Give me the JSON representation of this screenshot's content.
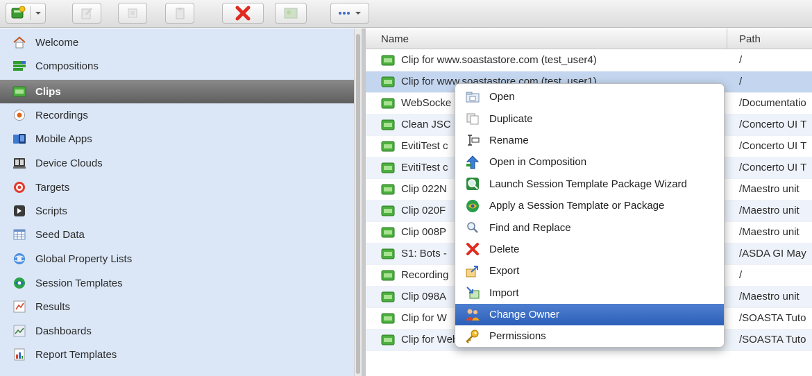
{
  "sidebar": {
    "items": [
      {
        "label": "Welcome",
        "icon": "home-icon"
      },
      {
        "label": "Compositions",
        "icon": "compositions-icon"
      },
      {
        "label": "Clips",
        "icon": "clip-icon",
        "selected": true
      },
      {
        "label": "Recordings",
        "icon": "recording-icon"
      },
      {
        "label": "Mobile Apps",
        "icon": "mobile-apps-icon"
      },
      {
        "label": "Device Clouds",
        "icon": "device-clouds-icon"
      },
      {
        "label": "Targets",
        "icon": "target-icon"
      },
      {
        "label": "Scripts",
        "icon": "scripts-icon"
      },
      {
        "label": "Seed Data",
        "icon": "seed-data-icon"
      },
      {
        "label": "Global Property Lists",
        "icon": "global-property-icon"
      },
      {
        "label": "Session Templates",
        "icon": "session-templates-icon"
      },
      {
        "label": "Results",
        "icon": "results-icon"
      },
      {
        "label": "Dashboards",
        "icon": "dashboards-icon"
      },
      {
        "label": "Report Templates",
        "icon": "report-templates-icon"
      }
    ]
  },
  "table": {
    "headers": {
      "name": "Name",
      "path": "Path"
    },
    "rows": [
      {
        "name": "Clip for www.soastastore.com (test_user4)",
        "path": "/"
      },
      {
        "name": "Clip for www.soastastore.com (test_user1)",
        "path": "/",
        "selected": true
      },
      {
        "name": "WebSocke",
        "path": "/Documentatio"
      },
      {
        "name": "Clean JSC",
        "path": "/Concerto UI T"
      },
      {
        "name": "EvitiTest c",
        "path": "/Concerto UI T"
      },
      {
        "name": "EvitiTest c",
        "path": "/Concerto UI T"
      },
      {
        "name": "Clip 022N",
        "path": "/Maestro unit"
      },
      {
        "name": "Clip 020F",
        "path": "/Maestro unit"
      },
      {
        "name": "Clip 008P",
        "path": "/Maestro unit"
      },
      {
        "name": "S1: Bots -",
        "path": "/ASDA GI May"
      },
      {
        "name": "Recording",
        "path": "/"
      },
      {
        "name": "Clip 098A",
        "path": "/Maestro unit"
      },
      {
        "name": "Clip for W",
        "path": "/SOASTA Tuto"
      },
      {
        "name": "Clip for Web Target www.soasta.com",
        "path": "/SOASTA Tuto"
      }
    ]
  },
  "context_menu": {
    "items": [
      {
        "label": "Open",
        "icon": "open-icon"
      },
      {
        "label": "Duplicate",
        "icon": "duplicate-icon"
      },
      {
        "label": "Rename",
        "icon": "rename-icon"
      },
      {
        "label": "Open in Composition",
        "icon": "open-in-composition-icon"
      },
      {
        "label": "Launch Session Template Package Wizard",
        "icon": "wizard-icon"
      },
      {
        "label": "Apply a Session Template or Package",
        "icon": "apply-template-icon"
      },
      {
        "label": "Find and Replace",
        "icon": "find-replace-icon"
      },
      {
        "label": "Delete",
        "icon": "delete-icon"
      },
      {
        "label": "Export",
        "icon": "export-icon"
      },
      {
        "label": "Import",
        "icon": "import-icon"
      },
      {
        "label": "Change Owner",
        "icon": "change-owner-icon",
        "active": true
      },
      {
        "label": "Permissions",
        "icon": "permissions-icon"
      }
    ]
  },
  "colors": {
    "sidebar_bg": "#dbe7f7",
    "selected_nav": "#6e6e6e",
    "menu_highlight": "#3a6cc4",
    "row_selected": "#c4d6ef",
    "clip_green": "#4caf3f"
  }
}
